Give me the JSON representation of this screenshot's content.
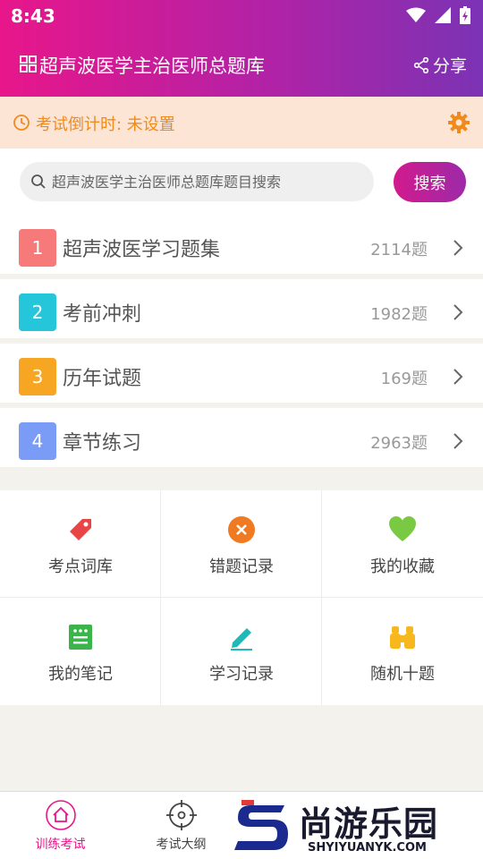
{
  "status_bar": {
    "time": "8:43"
  },
  "header": {
    "title": "超声波医学主治医师总题库",
    "share_label": "分享"
  },
  "countdown": {
    "text": "考试倒计时: 未设置"
  },
  "search": {
    "placeholder": "超声波医学主治医师总题库题目搜索",
    "button_label": "搜索"
  },
  "question_sets": [
    {
      "number": "1",
      "label": "超声波医学习题集",
      "count": "2114题",
      "color": "#f67a7a"
    },
    {
      "number": "2",
      "label": "考前冲刺",
      "count": "1982题",
      "color": "#26c6da"
    },
    {
      "number": "3",
      "label": "历年试题",
      "count": "169题",
      "color": "#f6a623"
    },
    {
      "number": "4",
      "label": "章节练习",
      "count": "2963题",
      "color": "#7b9cf6"
    }
  ],
  "tools": [
    {
      "label": "考点词库",
      "icon": "tag-icon",
      "color": "#e84646"
    },
    {
      "label": "错题记录",
      "icon": "close-circle-icon",
      "color": "#f07a22"
    },
    {
      "label": "我的收藏",
      "icon": "heart-icon",
      "color": "#7ac943"
    },
    {
      "label": "我的笔记",
      "icon": "notes-icon",
      "color": "#3bb54a"
    },
    {
      "label": "学习记录",
      "icon": "pencil-icon",
      "color": "#22b8b8"
    },
    {
      "label": "随机十题",
      "icon": "binoculars-icon",
      "color": "#f6b81c"
    }
  ],
  "tabs": [
    {
      "label": "训练考试",
      "icon": "home-icon",
      "active": true
    },
    {
      "label": "考试大纲",
      "icon": "target-icon",
      "active": false
    }
  ],
  "watermark": {
    "text": "尚游乐园",
    "url": "SHYIYUANYK.COM"
  },
  "colors": {
    "accent": "#d21a8d",
    "countdown_text": "#f08a1c",
    "active_tab": "#e8168a"
  }
}
